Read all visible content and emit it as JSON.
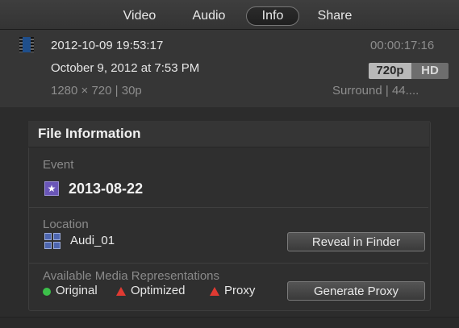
{
  "tabs": [
    {
      "label": "Video"
    },
    {
      "label": "Audio"
    },
    {
      "label": "Info"
    },
    {
      "label": "Share"
    }
  ],
  "clip": {
    "name": "2012-10-09 19:53:17",
    "timecode": "00:00:17:16",
    "date": "October 9, 2012 at 7:53 PM",
    "format_res": "720p",
    "format_hd": "HD",
    "specs": "1280 × 720  |  30p",
    "audio_specs": "Surround  |  44...."
  },
  "file_info": {
    "title": "File Information",
    "event_label": "Event",
    "event_name": "2013-08-22",
    "location_label": "Location",
    "location_name": "Audi_01",
    "reveal_button": "Reveal in Finder",
    "media_label": "Available Media Representations",
    "rep_original": "Original",
    "rep_optimized": "Optimized",
    "rep_proxy": "Proxy",
    "generate_button": "Generate Proxy"
  },
  "icons": {
    "clip": "film-strip-icon",
    "event": "star-icon",
    "location": "library-grid-icon",
    "original_status": "green-dot-icon",
    "optimized_status": "red-triangle-icon",
    "proxy_status": "red-triangle-icon"
  },
  "colors": {
    "available": "#3cc04a",
    "missing": "#e03a32",
    "event_icon": "#6a56b8"
  }
}
